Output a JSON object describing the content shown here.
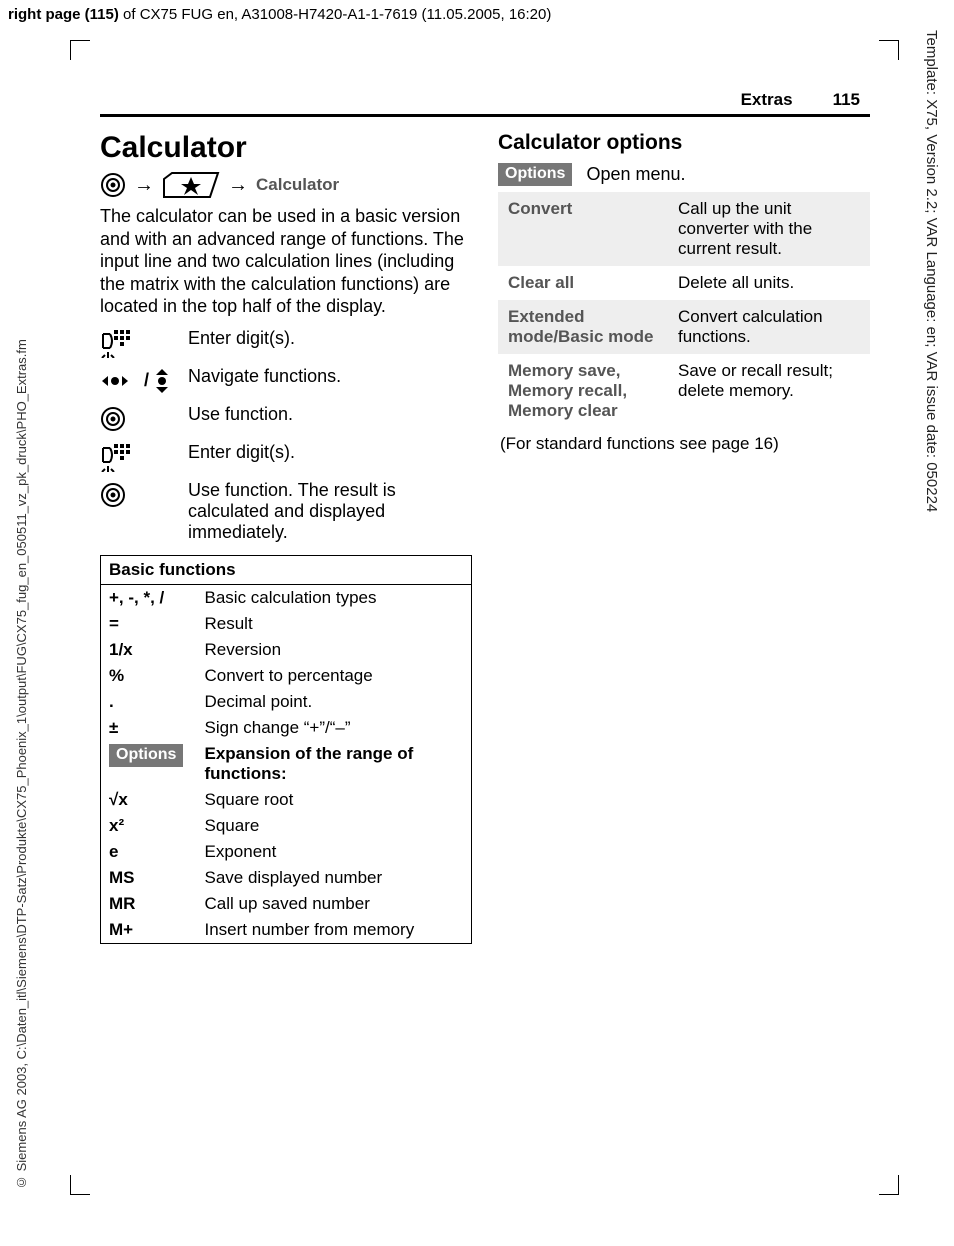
{
  "meta": {
    "top_left_bold": "right page (115)",
    "top_left_rest": " of CX75 FUG en, A31008-H7420-A1-1-7619 (11.05.2005, 16:20)",
    "side_left": "© Siemens AG 2003, C:\\Daten_itl\\Siemens\\DTP-Satz\\Produkte\\CX75_Phoenix_1\\output\\FUG\\CX75_fug_en_050511_vz_pk_druck\\PHO_Extras.fm",
    "side_right": "Template: X75, Version 2.2; VAR Language: en; VAR issue date: 050224"
  },
  "header": {
    "section": "Extras",
    "page": "115"
  },
  "left": {
    "h1": "Calculator",
    "nav_label": "Calculator",
    "intro": "The calculator can be used in a basic version and with an advanced range of functions. The input line and two calculation lines (including the matrix with the calculation functions) are located in the top half of the display.",
    "steps": [
      {
        "icon": "keypad",
        "text": "Enter digit(s)."
      },
      {
        "icon": "nav-arrows",
        "text": "Navigate functions."
      },
      {
        "icon": "center-key",
        "text": "Use function."
      },
      {
        "icon": "keypad",
        "text": "Enter digit(s)."
      },
      {
        "icon": "center-key",
        "text": "Use function. The result is calculated and displayed immediately."
      }
    ],
    "table_title": "Basic functions",
    "basic_rows": [
      {
        "sym": "+, -, *, /",
        "desc": "Basic calculation types"
      },
      {
        "sym": "=",
        "desc": "Result"
      },
      {
        "sym": "1/x",
        "desc": "Reversion"
      },
      {
        "sym": "%",
        "desc": "Convert to percentage"
      },
      {
        "sym": ".",
        "desc": "Decimal point."
      },
      {
        "sym": "±",
        "desc": "Sign change “+”/“–”"
      }
    ],
    "options_label": "Options",
    "options_desc": "Expansion of the range of functions:",
    "ext_rows": [
      {
        "sym": "√x",
        "desc": "Square root"
      },
      {
        "sym": "x²",
        "desc": "Square"
      },
      {
        "sym": "e",
        "desc": "Exponent"
      },
      {
        "sym": "MS",
        "desc": "Save displayed number"
      },
      {
        "sym": "MR",
        "desc": "Call up saved number"
      },
      {
        "sym": "M+",
        "desc": "Insert number from memory"
      }
    ]
  },
  "right": {
    "h2": "Calculator options",
    "options_label": "Options",
    "open_menu": "Open menu.",
    "rows": [
      {
        "k": "Convert",
        "v": "Call up the unit converter with the current result."
      },
      {
        "k": "Clear all",
        "v": "Delete all units."
      },
      {
        "k": "Extended mode/Basic mode",
        "v": "Convert calculation functions."
      },
      {
        "k": "Memory save, Memory recall, Memory clear",
        "v": "Save or recall result; delete memory."
      }
    ],
    "footnote": "(For standard functions see page 16)"
  }
}
